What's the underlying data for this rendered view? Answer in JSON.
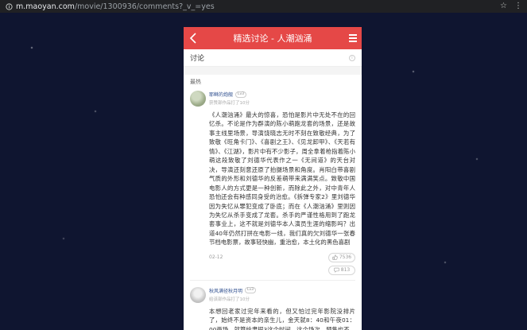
{
  "browser": {
    "url_domain": "m.maoyan.com",
    "url_path": "/movie/1300936/comments?_v_=yes"
  },
  "header": {
    "title": "精选讨论 - 人潮汹涌"
  },
  "section": {
    "title": "讨论",
    "info_icon": "i"
  },
  "hot_label": "最热",
  "comments": [
    {
      "username": "耶稣的炮舰",
      "level": "Lv3",
      "subtitle": "获赞部作品打了10分",
      "body": "《人潮汹涌》最大的惊喜，恐怕是影片中无处不在的回忆杀。不论是作为群演的陈小萌跑龙套的场景，还是故事主线里场景，导演饶晓志无时不刻在致敬经典，为了致敬《旺角卡门》、《喜剧之王》、《见龙卸甲》、《天若有情》、《江湖》，影片中有不少影子，周全拿着枪指着陈小萌这段致敬了刘德华代表作之一《无间道》的天台对决，导演还刻意还原了拍摄场景和角度。肖阳白带喜剧气质的外形和刘德华的反差萌带来满满笑点。致敬中国电影人的方式更是一种创新，而除此之外，对中青年人恐怕还会有种感同身受的治愈。《拆弹专家2》里刘德华因为失忆从罪犯变成了卧底；而在《人潮汹涌》里则因为失忆从杀手变成了龙套。杀手的严谨性格用到了跑龙套事业上，这不就是刘德华本人演员生涯的缩影吗？出道40年仍然打拼在电影一线，我们真的欠刘德华一张春节档电影票，故事轻快幽，重治愈，本土化的黑色喜剧",
      "date": "02-12",
      "likes": "7536",
      "replies": "813"
    },
    {
      "username": "秋风满径秋月明",
      "level": "Lv3",
      "subtitle": "给该部作品打了10分",
      "body": "本想回老家过完年来看的，但又怕过完年影院没排片了，始终不是资本的亲生儿，金天就8：40和午夜01：00两场，就算给肃探3这个时间，这个场次，预售也不",
      "date": "",
      "likes": "",
      "replies": ""
    }
  ],
  "colors": {
    "brand_red": "#e54847",
    "username_blue": "#2f4f8f"
  }
}
